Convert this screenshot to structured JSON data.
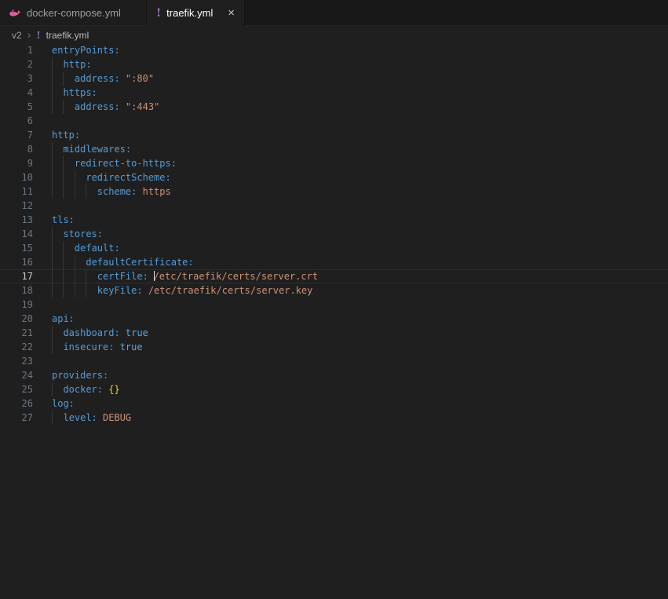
{
  "tabs": [
    {
      "label": "docker-compose.yml",
      "icon": "docker-whale",
      "state": "inactive"
    },
    {
      "label": "traefik.yml",
      "icon": "yaml-exclamation",
      "state": "active",
      "close_label": "×"
    }
  ],
  "icons": {
    "yaml_glyph": "!",
    "chevron_glyph": "›"
  },
  "breadcrumb": {
    "folder": "v2",
    "file": "traefik.yml"
  },
  "editor": {
    "language": "yaml",
    "active_line": 17,
    "token_colors": {
      "key": "#569CD6",
      "str": "#CE9178",
      "bool": "#5CA7DD",
      "punct": "#FFD700",
      "plain": "#D4D4D4"
    },
    "lines": [
      {
        "num": 1,
        "indent": 0,
        "tokens": [
          [
            "key",
            "entryPoints:"
          ]
        ]
      },
      {
        "num": 2,
        "indent": 1,
        "tokens": [
          [
            "key",
            "http:"
          ]
        ]
      },
      {
        "num": 3,
        "indent": 2,
        "tokens": [
          [
            "key",
            "address:"
          ],
          [
            "plain",
            " "
          ],
          [
            "str",
            "\":80\""
          ]
        ]
      },
      {
        "num": 4,
        "indent": 1,
        "tokens": [
          [
            "key",
            "https:"
          ]
        ]
      },
      {
        "num": 5,
        "indent": 2,
        "tokens": [
          [
            "key",
            "address:"
          ],
          [
            "plain",
            " "
          ],
          [
            "str",
            "\":443\""
          ]
        ]
      },
      {
        "num": 6,
        "indent": 0,
        "tokens": []
      },
      {
        "num": 7,
        "indent": 0,
        "tokens": [
          [
            "key",
            "http:"
          ]
        ]
      },
      {
        "num": 8,
        "indent": 1,
        "tokens": [
          [
            "key",
            "middlewares:"
          ]
        ]
      },
      {
        "num": 9,
        "indent": 2,
        "tokens": [
          [
            "key",
            "redirect-to-https:"
          ]
        ]
      },
      {
        "num": 10,
        "indent": 3,
        "tokens": [
          [
            "key",
            "redirectScheme:"
          ]
        ]
      },
      {
        "num": 11,
        "indent": 4,
        "tokens": [
          [
            "key",
            "scheme:"
          ],
          [
            "plain",
            " "
          ],
          [
            "str",
            "https"
          ]
        ]
      },
      {
        "num": 12,
        "indent": 0,
        "tokens": []
      },
      {
        "num": 13,
        "indent": 0,
        "tokens": [
          [
            "key",
            "tls:"
          ]
        ]
      },
      {
        "num": 14,
        "indent": 1,
        "tokens": [
          [
            "key",
            "stores:"
          ]
        ]
      },
      {
        "num": 15,
        "indent": 2,
        "tokens": [
          [
            "key",
            "default:"
          ]
        ]
      },
      {
        "num": 16,
        "indent": 3,
        "tokens": [
          [
            "key",
            "defaultCertificate:"
          ]
        ]
      },
      {
        "num": 17,
        "indent": 4,
        "tokens": [
          [
            "key",
            "certFile:"
          ],
          [
            "plain",
            " "
          ],
          [
            "cursor",
            ""
          ],
          [
            "str",
            "/etc/traefik/certs/server.crt"
          ]
        ]
      },
      {
        "num": 18,
        "indent": 4,
        "tokens": [
          [
            "key",
            "keyFile:"
          ],
          [
            "plain",
            " "
          ],
          [
            "str",
            "/etc/traefik/certs/server.key"
          ]
        ]
      },
      {
        "num": 19,
        "indent": 0,
        "tokens": []
      },
      {
        "num": 20,
        "indent": 0,
        "tokens": [
          [
            "key",
            "api:"
          ]
        ]
      },
      {
        "num": 21,
        "indent": 1,
        "tokens": [
          [
            "key",
            "dashboard:"
          ],
          [
            "plain",
            " "
          ],
          [
            "bool",
            "true"
          ]
        ]
      },
      {
        "num": 22,
        "indent": 1,
        "tokens": [
          [
            "key",
            "insecure:"
          ],
          [
            "plain",
            " "
          ],
          [
            "bool",
            "true"
          ]
        ]
      },
      {
        "num": 23,
        "indent": 0,
        "tokens": []
      },
      {
        "num": 24,
        "indent": 0,
        "tokens": [
          [
            "key",
            "providers:"
          ]
        ]
      },
      {
        "num": 25,
        "indent": 1,
        "tokens": [
          [
            "key",
            "docker:"
          ],
          [
            "plain",
            " "
          ],
          [
            "punct",
            "{}"
          ]
        ]
      },
      {
        "num": 26,
        "indent": 0,
        "tokens": [
          [
            "key",
            "log:"
          ]
        ]
      },
      {
        "num": 27,
        "indent": 1,
        "tokens": [
          [
            "key",
            "level:"
          ],
          [
            "plain",
            " "
          ],
          [
            "str",
            "DEBUG"
          ]
        ]
      }
    ]
  },
  "colors": {
    "editor_bg": "#1F1F1F",
    "tabstrip_bg": "#181818",
    "tab_inactive_bg": "#1D1D1D",
    "tab_active_bg": "#1F1F1F",
    "tab_inactive_fg": "#9D9D9D",
    "tab_active_fg": "#FFFFFF",
    "docker_icon_pink": "#E0609A",
    "yaml_icon_purple": "#A074C8",
    "line_number": "#6E7681",
    "line_number_active": "#C6C6C6",
    "indent_guide": "#373737",
    "active_line_border": "#2D2D2D",
    "cursor": "#E6E6E6"
  }
}
